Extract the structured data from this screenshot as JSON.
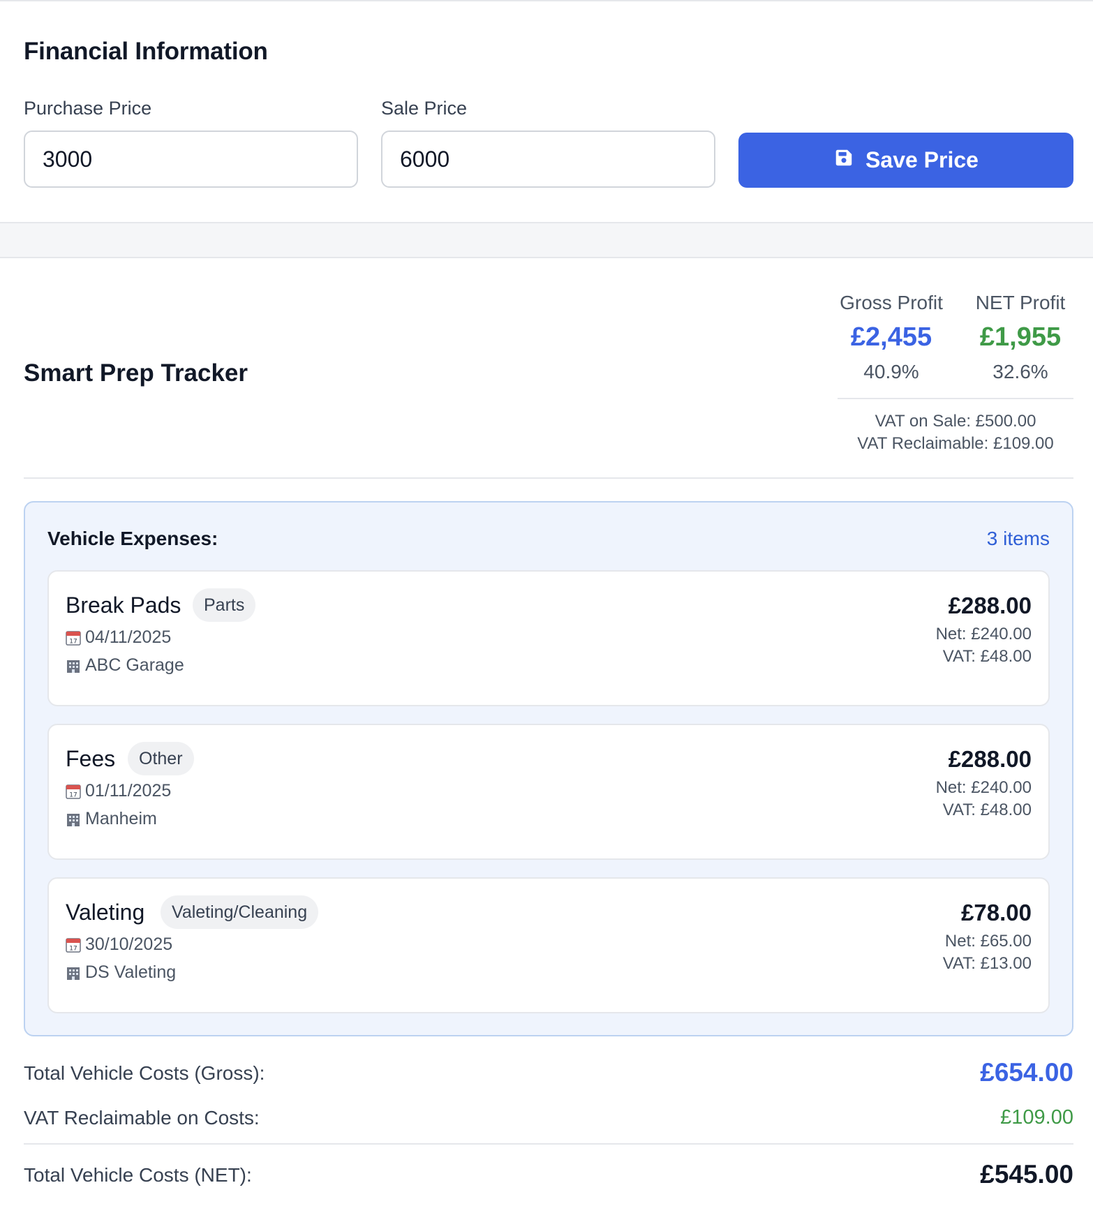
{
  "financial": {
    "title": "Financial Information",
    "purchase_label": "Purchase Price",
    "purchase_value": "3000",
    "sale_label": "Sale Price",
    "sale_value": "6000",
    "save_label": "Save Price"
  },
  "tracker": {
    "title": "Smart Prep Tracker",
    "gross": {
      "label": "Gross Profit",
      "value": "£2,455",
      "pct": "40.9%",
      "color": "#3b63e3"
    },
    "net": {
      "label": "NET Profit",
      "value": "£1,955",
      "pct": "32.6%",
      "color": "#3f9a47"
    },
    "vat_on_sale": "VAT on Sale: £500.00",
    "vat_reclaimable": "VAT Reclaimable: £109.00"
  },
  "expenses": {
    "header": "Vehicle Expenses:",
    "count": "3 items",
    "items": [
      {
        "name": "Break Pads",
        "tag": "Parts",
        "date": "04/11/2025",
        "supplier": "ABC Garage",
        "total": "£288.00",
        "net": "Net: £240.00",
        "vat": "VAT: £48.00"
      },
      {
        "name": "Fees",
        "tag": "Other",
        "date": "01/11/2025",
        "supplier": "Manheim",
        "total": "£288.00",
        "net": "Net: £240.00",
        "vat": "VAT: £48.00"
      },
      {
        "name": "Valeting",
        "tag": "Valeting/Cleaning",
        "date": "30/10/2025",
        "supplier": "DS Valeting",
        "total": "£78.00",
        "net": "Net: £65.00",
        "vat": "VAT: £13.00"
      }
    ]
  },
  "totals": {
    "gross_label": "Total Vehicle Costs (Gross):",
    "gross_value": "£654.00",
    "vat_label": "VAT Reclaimable on Costs:",
    "vat_value": "£109.00",
    "net_label": "Total Vehicle Costs (NET):",
    "net_value": "£545.00"
  },
  "colors": {
    "primary": "#3b63e3",
    "success": "#3f9a47"
  }
}
